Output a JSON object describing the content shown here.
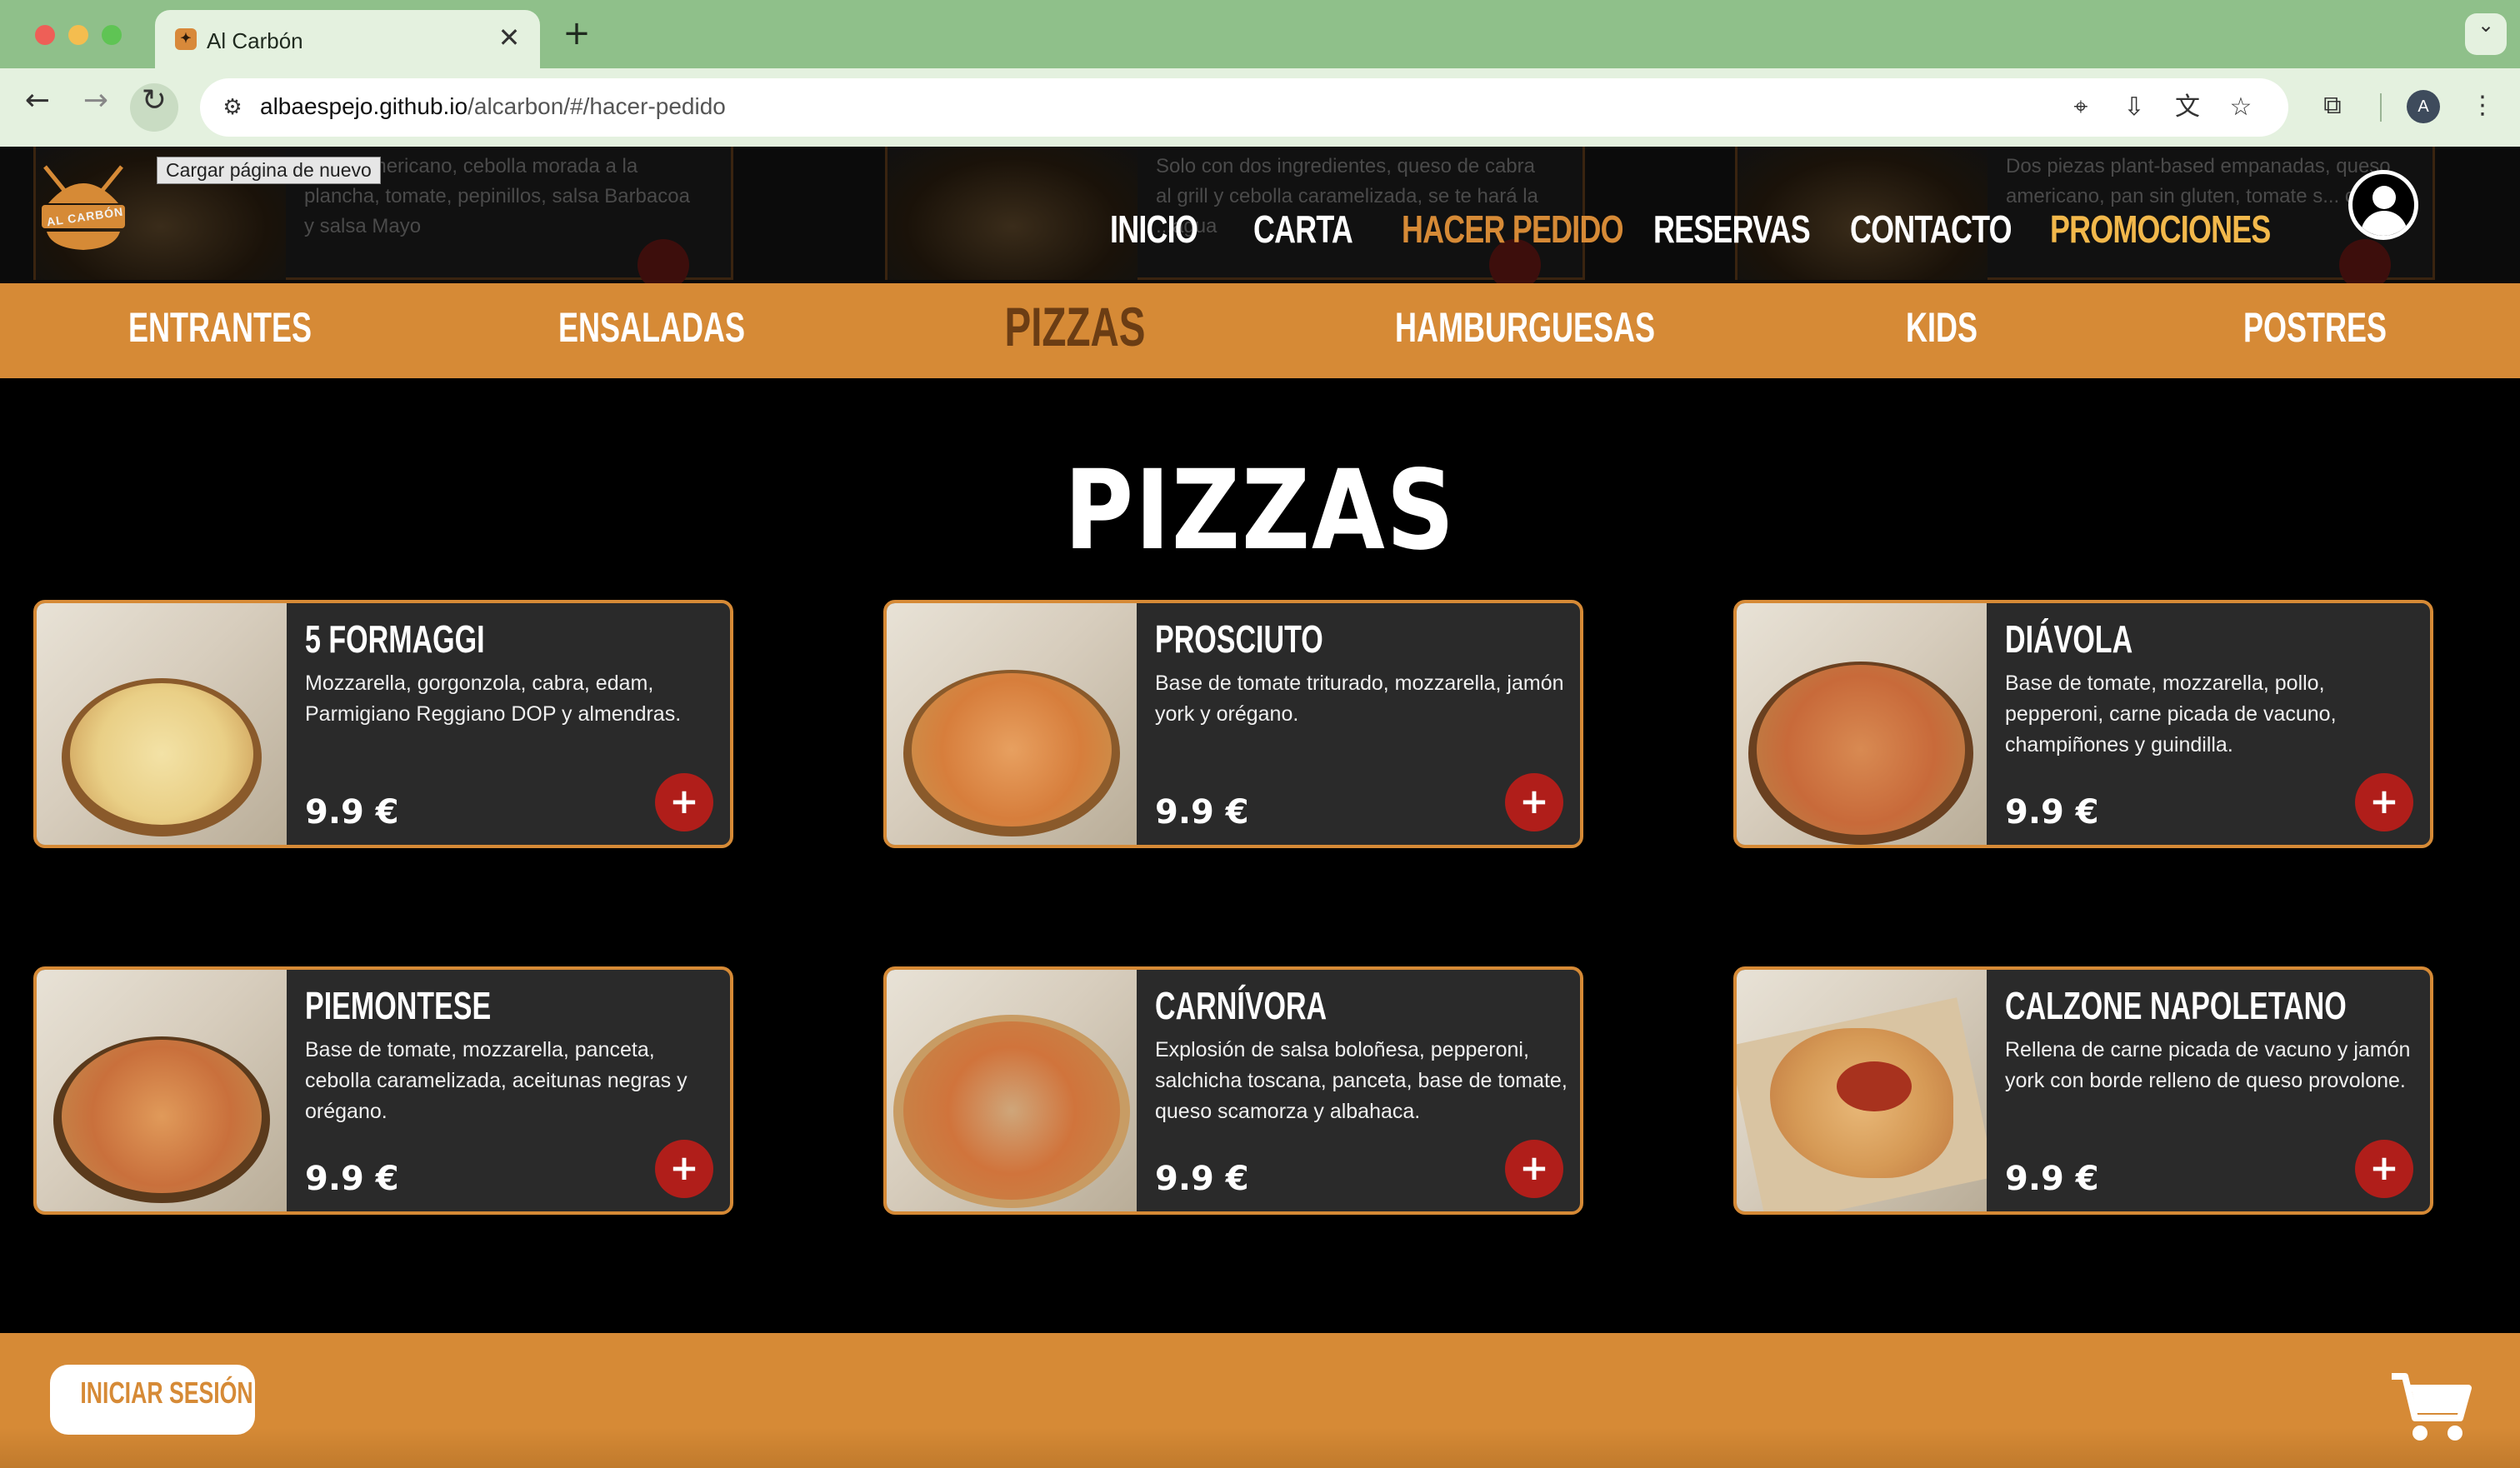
{
  "browser": {
    "tab_title": "Al Carbón",
    "tab_close": "✕",
    "new_tab": "+",
    "url_host": "albaespejo.github.io",
    "url_path": "/alcarbon/#/hacer-pedido",
    "reload_tooltip": "Cargar página de nuevo",
    "profile_initial": "A"
  },
  "header": {
    "logo_text": "AL CARBÓN",
    "nav": [
      "INICIO",
      "CARTA",
      "HACER PEDIDO",
      "RESERVAS",
      "CONTACTO",
      "PROMOCIONES"
    ],
    "active_nav": "HACER PEDIDO",
    "background_cards": [
      "...eso americano, cebolla morada a la plancha, tomate, pepinillos, salsa Barbacoa y salsa Mayo",
      "Solo con dos ingredientes, queso de cabra al grill y cebolla caramelizada, se te hará la ...agua",
      "Dos piezas plant-based empanadas, queso americano, pan sin gluten, tomate s... conf..."
    ]
  },
  "categories": [
    "ENTRANTES",
    "ENSALADAS",
    "PIZZAS",
    "HAMBURGUESAS",
    "KIDS",
    "POSTRES"
  ],
  "active_category": "PIZZAS",
  "section_title": "PIZZAS",
  "products": [
    {
      "name": "5 FORMAGGI",
      "description": "Mozzarella, gorgonzola, cabra, edam, Parmigiano Reggiano DOP y almendras.",
      "price": "9.9 €",
      "add": "+",
      "style": "cheese"
    },
    {
      "name": "PROSCIUTO",
      "description": "Base de tomate triturado, mozzarella, jamón york y orégano.",
      "price": "9.9 €",
      "add": "+",
      "style": "ham"
    },
    {
      "name": "DIÁVOLA",
      "description": "Base de tomate, mozzarella, pollo, pepperoni, carne picada de vacuno, champiñones y guindilla.",
      "price": "9.9 €",
      "add": "+",
      "style": "spicy"
    },
    {
      "name": "PIEMONTESE",
      "description": "Base de tomate, mozzarella, panceta, cebolla caramelizada, aceitunas negras y orégano.",
      "price": "9.9 €",
      "add": "+",
      "style": "olive"
    },
    {
      "name": "CARNÍVORA",
      "description": "Explosión de salsa boloñesa, pepperoni, salchicha toscana, panceta, base de tomate, queso scamorza y albahaca.",
      "price": "9.9 €",
      "add": "+",
      "style": "meat"
    },
    {
      "name": "CALZONE NAPOLETANO",
      "description": "Rellena de carne picada de vacuno y jamón york con borde relleno de queso provolone.",
      "price": "9.9 €",
      "add": "+",
      "style": "calzone"
    }
  ],
  "footer": {
    "login_label": "INICIAR SESIÓN"
  },
  "colors": {
    "accent": "#d68a36",
    "accent_dark": "#6b3d14",
    "promo": "#f2b84b",
    "add_button": "#b01e1a",
    "card_bg": "#2a2a2a"
  }
}
